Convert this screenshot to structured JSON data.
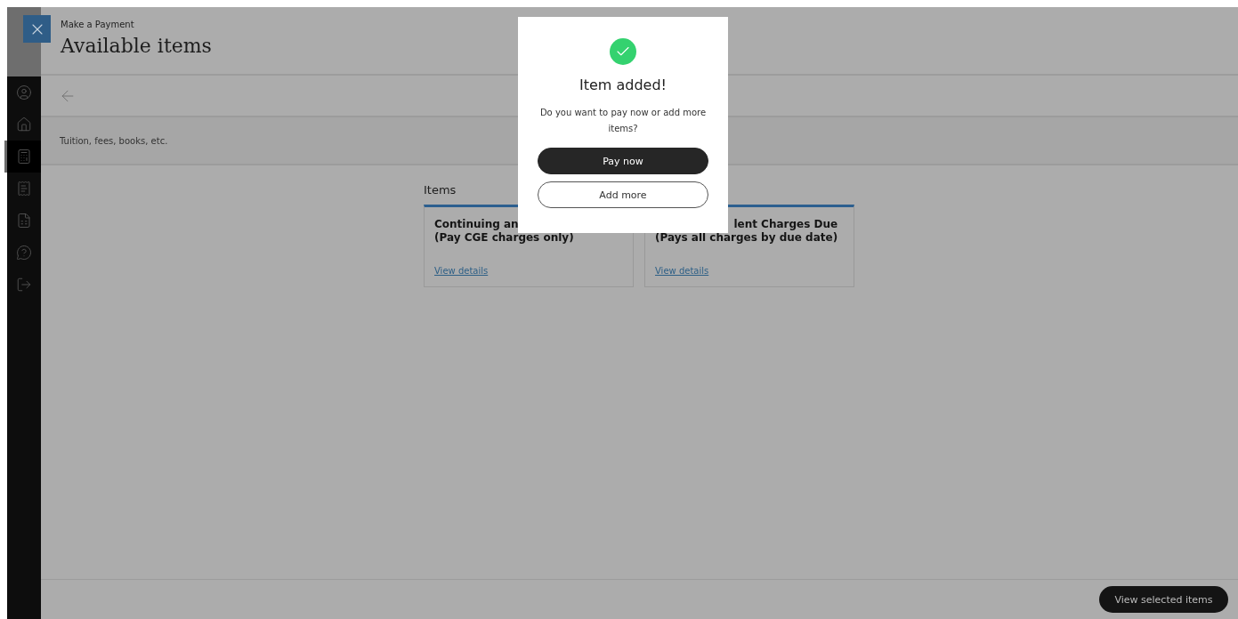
{
  "header": {
    "breadcrumb": "Make a Payment",
    "title": "Available items"
  },
  "sidebar": {
    "items": [
      {
        "selected": false
      },
      {
        "selected": false
      },
      {
        "selected": true
      },
      {
        "selected": false
      },
      {
        "selected": false
      },
      {
        "selected": false
      },
      {
        "selected": false
      }
    ]
  },
  "category": "Tuition, fees, books, etc.",
  "section_title": "Items",
  "cards": [
    {
      "title_lines": [
        "Continuing an",
        "(Pay CGE charges only)"
      ],
      "link": "View details"
    },
    {
      "title_lines": [
        "lent Charges Due",
        "(Pays all charges by due date)"
      ],
      "link": "View details"
    }
  ],
  "dialog": {
    "title": "Item added!",
    "message": "Do you want to pay now or add more items?",
    "buttons": [
      {
        "label": "Pay now",
        "kind": "primary"
      },
      {
        "label": "Add more",
        "kind": "secondary"
      }
    ]
  },
  "footer": {
    "button": "View selected items"
  }
}
